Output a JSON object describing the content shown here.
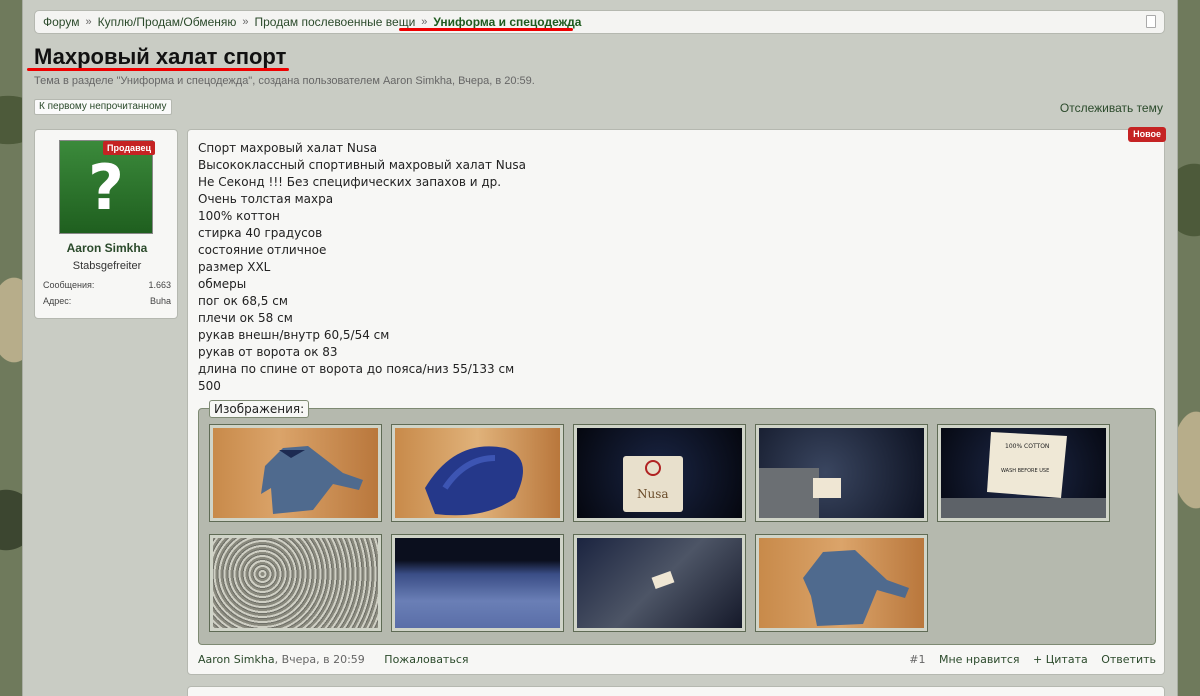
{
  "breadcrumb": [
    {
      "label": "Форум"
    },
    {
      "label": "Куплю/Продам/Обменяю"
    },
    {
      "label": "Продам послевоенные вещи"
    },
    {
      "label": "Униформа и спецодежда"
    }
  ],
  "breadcrumb_sep": "»",
  "thread": {
    "title": "Махровый халат спорт",
    "subtitle": "Тема в разделе \"Униформа и спецодежда\", создана пользователем Aaron Simkha, Вчера, в 20:59."
  },
  "actions": {
    "first_unread": "К первому непрочитанному",
    "watch": "Отслеживать тему"
  },
  "user": {
    "avatar_glyph": "?",
    "badge": "Продавец",
    "name": "Aaron Simkha",
    "rank": "Stabsgefreiter",
    "stats": [
      {
        "label": "Сообщения:",
        "value": "1.663"
      },
      {
        "label": "Адрес:",
        "value": "Buha"
      }
    ]
  },
  "post": {
    "new_badge": "Новое",
    "lines": [
      "Спорт махровый халат Nusa",
      "Высококлассный спортивный махровый халат Nusa",
      "Не Секонд !!! Без специфических запахов и др.",
      "Очень толстая махра",
      "100% коттон",
      "стирка 40 градусов",
      "состояние отличное",
      "размер XXL",
      "обмеры",
      "пог ок 68,5 см",
      "плечи ок 58 см",
      "рукав внешн/внутр 60,5/54 см",
      "рукав от ворота ок 83",
      "длина по спине от ворота до пояса/низ 55/133 см",
      "500"
    ],
    "attachments_label": "Изображения:",
    "thumb_labels": [
      "Nusa",
      "100% COTTON",
      "WASH BEFORE USE"
    ],
    "footer": {
      "author": "Aaron Simkha",
      "date": ", Вчера, в 20:59",
      "report": "Пожаловаться",
      "number": "#1",
      "like": "Мне нравится",
      "quote": "+ Цитата",
      "reply": "Ответить"
    }
  },
  "colors": {
    "accent": "#2b4a2b",
    "badge": "#c52323",
    "highlight_underline": "#e00000"
  }
}
